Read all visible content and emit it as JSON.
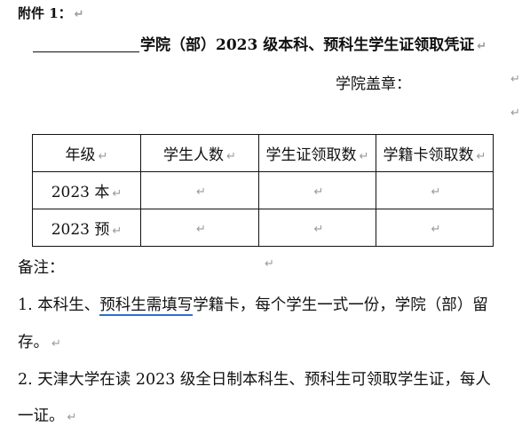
{
  "annex_label": "附件 1：",
  "title": "学院（部）2023 级本科、预科生学生证领取凭证",
  "seal_label": "学院盖章：",
  "table": {
    "headers": [
      "年级",
      "学生人数",
      "学生证领取数",
      "学籍卡领取数"
    ],
    "rows": [
      [
        "2023 本",
        "",
        "",
        ""
      ],
      [
        "2023 预",
        "",
        "",
        ""
      ]
    ]
  },
  "notes": {
    "label": "备注：",
    "item1_part1": "1. 本科生、",
    "item1_underlined": "预科生需填写",
    "item1_part2": "学籍卡，每个学生一式一份，学院（部）留",
    "item1_cont": "存。",
    "item2": "2.  天津大学在读 2023 级全日制本科生、预科生可领取学生证，每人",
    "item2_cont": "一证。"
  },
  "paragraph_mark": "↵"
}
